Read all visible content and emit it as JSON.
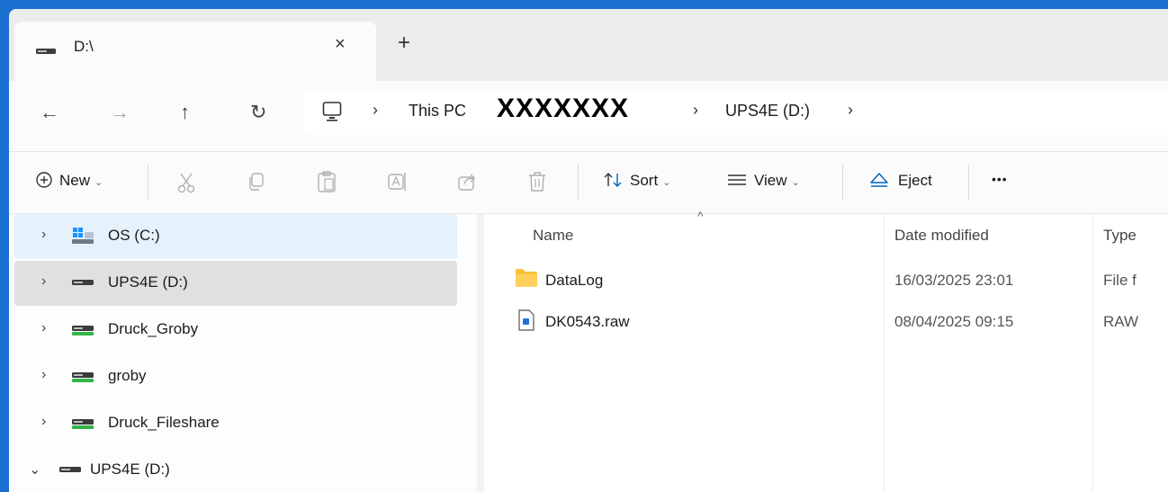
{
  "tab": {
    "title": "D:\\",
    "close_icon": "×",
    "new_tab_icon": "+"
  },
  "nav": {
    "back": "←",
    "forward": "→",
    "up": "↑",
    "refresh": "↻"
  },
  "address": {
    "sep": "›",
    "crumb_this_pc": "This PC",
    "crumb_redacted": "XXXXXXX",
    "crumb_drive": "UPS4E (D:)"
  },
  "toolbar": {
    "new_label": "New",
    "sort_label": "Sort",
    "view_label": "View",
    "eject_label": "Eject",
    "more_label": "•••",
    "chevron": "⌄"
  },
  "tree": {
    "items": [
      {
        "label": "OS (C:)",
        "chevron": "›",
        "icon": "windows-drive-icon"
      },
      {
        "label": "UPS4E (D:)",
        "chevron": "›",
        "icon": "drive-icon"
      },
      {
        "label": "Druck_Groby",
        "chevron": "›",
        "icon": "network-drive-icon"
      },
      {
        "label": "groby",
        "chevron": "›",
        "icon": "network-drive-icon"
      },
      {
        "label": "Druck_Fileshare",
        "chevron": "›",
        "icon": "network-drive-icon"
      },
      {
        "label": "UPS4E (D:)",
        "chevron": "⌄",
        "icon": "drive-icon"
      }
    ]
  },
  "columns": {
    "name": "Name",
    "date": "Date modified",
    "type": "Type"
  },
  "files": [
    {
      "name": "DataLog",
      "date": "16/03/2025 23:01",
      "type": "File f",
      "icon": "folder-icon"
    },
    {
      "name": "DK0543.raw",
      "date": "08/04/2025 09:15",
      "type": "RAW",
      "icon": "file-icon"
    }
  ],
  "colors": {
    "accent": "#0067c0",
    "folder": "#f8c33b",
    "network_drive_green": "#35b44a"
  }
}
